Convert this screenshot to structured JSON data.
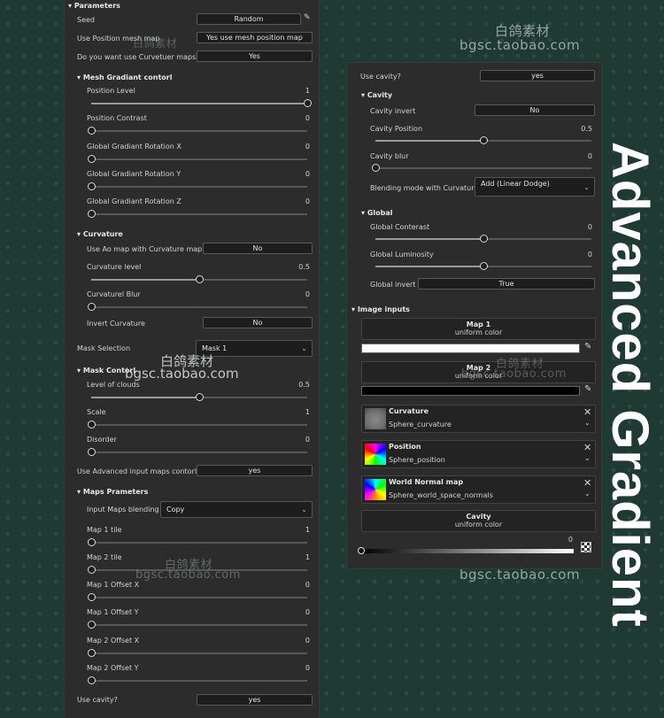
{
  "watermarks": {
    "cn": "白鸽素材",
    "url": "bgsc.taobao.com"
  },
  "side_title": "Advanced Gradient",
  "left": {
    "header": "Parameters",
    "seed": {
      "label": "Seed",
      "button": "Random"
    },
    "use_position": {
      "label": "Use Position mesh map",
      "value": "Yes use mesh position map"
    },
    "curvature_q": {
      "label": "Do you want use Curvetuer maps?",
      "value": "Yes"
    },
    "mesh_section": "Mesh Gradiant contorl",
    "position_level": {
      "label": "Position Level",
      "value": "1",
      "fraction": 1
    },
    "position_contrast": {
      "label": "Position Contrast",
      "value": "0",
      "fraction": 0
    },
    "rot_x": {
      "label": "Global Gradiant Rotation X",
      "value": "0",
      "fraction": 0
    },
    "rot_y": {
      "label": "Global Gradiant Rotation Y",
      "value": "0",
      "fraction": 0
    },
    "rot_z": {
      "label": "Global Gradiant Rotation Z",
      "value": "0",
      "fraction": 0
    },
    "curvature_section": "Curvature",
    "ao_map": {
      "label": "Use Ao map with Curvature map?",
      "value": "No"
    },
    "curv_level": {
      "label": "Curvature level",
      "value": "0.5",
      "fraction": 0.5
    },
    "curv_blur": {
      "label": "Curvaturel Blur",
      "value": "0",
      "fraction": 0
    },
    "invert_curv": {
      "label": "Invert Curvature",
      "value": "No"
    },
    "mask_selection": {
      "label": "Mask Selection",
      "value": "Mask 1"
    },
    "mask_section": "Mask Contorl",
    "level_clouds": {
      "label": "Level of clouds",
      "value": "0.5",
      "fraction": 0.5
    },
    "scale": {
      "label": "Scale",
      "value": "1",
      "fraction": 0
    },
    "disorder": {
      "label": "Disorder",
      "value": "0",
      "fraction": 0
    },
    "adv_input": {
      "label": "Use Advanced input maps contorl",
      "value": "yes"
    },
    "maps_section": "Maps Prameters",
    "input_blend": {
      "label": "Input Maps blending",
      "value": "Copy"
    },
    "map1_tile": {
      "label": "Map 1 tile",
      "value": "1",
      "fraction": 0
    },
    "map2_tile": {
      "label": "Map 2 tile",
      "value": "1",
      "fraction": 0
    },
    "map1_ox": {
      "label": "Map 1 Offset X",
      "value": "0",
      "fraction": 0
    },
    "map1_oy": {
      "label": "Map 1 Offset Y",
      "value": "0",
      "fraction": 0
    },
    "map2_ox": {
      "label": "Map 2 Offset X",
      "value": "0",
      "fraction": 0
    },
    "map2_oy": {
      "label": "Map 2 Offset Y",
      "value": "0",
      "fraction": 0
    },
    "use_cavity": {
      "label": "Use cavity?",
      "value": "yes"
    }
  },
  "right": {
    "use_cavity": {
      "label": "Use cavity?",
      "value": "yes"
    },
    "cavity_section": "Cavity",
    "cavity_invert": {
      "label": "Cavity invert",
      "value": "No"
    },
    "cavity_position": {
      "label": "Cavity Position",
      "value": "0.5",
      "fraction": 0.5
    },
    "cavity_blur": {
      "label": "Cavity blur",
      "value": "0",
      "fraction": 0
    },
    "blend_curv": {
      "label": "Blending mode with Curvature",
      "value": "Add (Linear Dodge)"
    },
    "global_section": "Global",
    "global_contrast": {
      "label": "Global Conterast",
      "value": "0",
      "fraction": 0.5
    },
    "global_lum": {
      "label": "Global Luminosity",
      "value": "0",
      "fraction": 0.5
    },
    "global_invert": {
      "label": "Global invert",
      "value": "True"
    },
    "image_section": "Image inputs",
    "map1": {
      "title": "Map 1",
      "sub": "uniform color",
      "color": "#ffffff"
    },
    "map2": {
      "title": "Map 2",
      "sub": "uniform color",
      "color": "#000000"
    },
    "curvature": {
      "title": "Curvature",
      "sub": "Sphere_curvature"
    },
    "position": {
      "title": "Position",
      "sub": "Sphere_position"
    },
    "world_normal": {
      "title": "World Normal map",
      "sub": "Sphere_world_space_normals"
    },
    "cavity_card": {
      "title": "Cavity",
      "sub": "uniform color",
      "value": "0"
    }
  }
}
